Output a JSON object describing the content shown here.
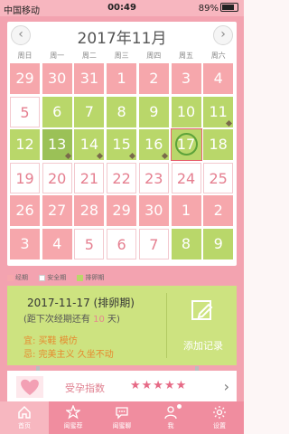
{
  "status_bar": {
    "carrier": "中国移动",
    "time": "00:49",
    "battery": "89%"
  },
  "calendar": {
    "title": "2017年11月",
    "weekdays": [
      "周日",
      "周一",
      "周二",
      "周三",
      "周四",
      "周五",
      "周六"
    ],
    "rows": [
      [
        "29",
        "30",
        "31",
        "1",
        "2",
        "3",
        "4"
      ],
      [
        "5",
        "6",
        "7",
        "8",
        "9",
        "10",
        "11"
      ],
      [
        "12",
        "13",
        "14",
        "15",
        "16",
        "17",
        "18"
      ],
      [
        "19",
        "20",
        "21",
        "22",
        "23",
        "24",
        "25"
      ],
      [
        "26",
        "27",
        "28",
        "29",
        "30",
        "1",
        "2"
      ],
      [
        "3",
        "4",
        "5",
        "6",
        "7",
        "8",
        "9"
      ]
    ],
    "types": [
      [
        "p",
        "p",
        "p",
        "p",
        "p",
        "p",
        "p"
      ],
      [
        "s",
        "o",
        "o",
        "o",
        "o",
        "o",
        "o"
      ],
      [
        "o",
        "od",
        "o",
        "o",
        "o",
        "today",
        "o"
      ],
      [
        "s",
        "s",
        "s",
        "s",
        "s",
        "s",
        "s"
      ],
      [
        "p",
        "p",
        "p",
        "p",
        "p",
        "p",
        "p"
      ],
      [
        "p",
        "p",
        "s",
        "s",
        "s",
        "o",
        "o"
      ]
    ],
    "selected": "17"
  },
  "legend": {
    "period": "经期",
    "safe": "安全期",
    "ovulation": "排卵期",
    "colors": {
      "period": "#f6a7ac",
      "safe": "#ffffff",
      "ovulation": "#b9d76a"
    }
  },
  "info": {
    "date_line": "2017-11-17 (排卵期)",
    "next_prefix": "(距下次经期还有",
    "next_days": "10",
    "next_suffix": "天)",
    "yi": "宜: 买鞋 模仿",
    "ji": "忌: 完美主义 久坐不动"
  },
  "add_record": {
    "label": "添加记录",
    "icon": "pencil-icon"
  },
  "fertility": {
    "label": "受孕指数",
    "stars": "★★★★★"
  },
  "tabs": [
    {
      "label": "首页",
      "icon": "home-icon",
      "active": true
    },
    {
      "label": "闺蜜荐",
      "icon": "star-icon",
      "active": false
    },
    {
      "label": "闺蜜聊",
      "icon": "chat-icon",
      "active": false
    },
    {
      "label": "我",
      "icon": "person-icon",
      "active": false
    },
    {
      "label": "设置",
      "icon": "gear-icon",
      "active": false
    }
  ]
}
